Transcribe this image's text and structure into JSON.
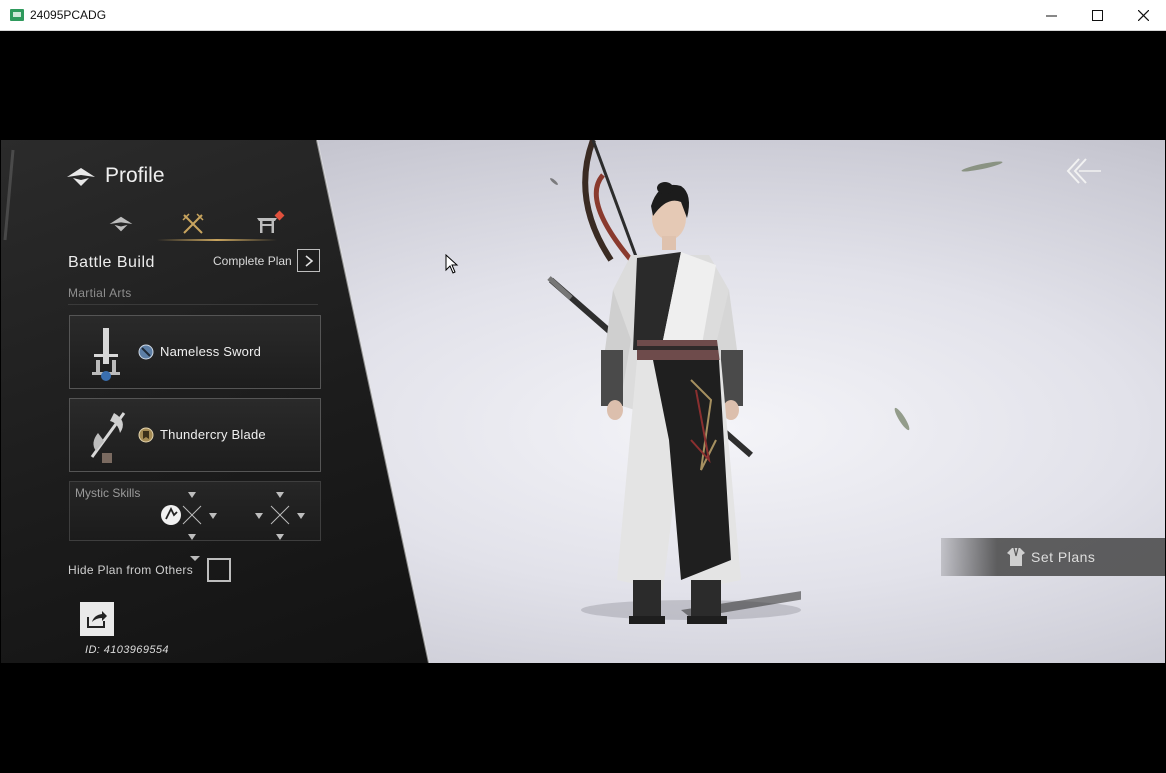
{
  "window": {
    "title": "24095PCADG",
    "minimize_icon": "minimize-icon",
    "maximize_icon": "maximize-icon",
    "close_icon": "close-icon"
  },
  "profile": {
    "title": "Profile",
    "tabs": [
      {
        "icon": "profile-emblem-icon",
        "active": false
      },
      {
        "icon": "crossed-swords-icon",
        "active": true
      },
      {
        "icon": "gate-icon",
        "active": false,
        "notification": true
      }
    ]
  },
  "battle_build": {
    "title": "Battle Build",
    "complete_plan_label": "Complete Plan",
    "martial_arts_label": "Martial Arts",
    "martial_arts": [
      {
        "name": "Nameless Sword",
        "weapon_icon": "sword-icon",
        "badge_icon": "nameless-badge-icon"
      },
      {
        "name": "Thundercry Blade",
        "weapon_icon": "halberd-icon",
        "badge_icon": "thundercry-badge-icon"
      }
    ],
    "mystic_skills_label": "Mystic Skills"
  },
  "hide_plan": {
    "label": "Hide Plan from Others",
    "checked": false
  },
  "player": {
    "id_text": "ID: 4103969554"
  },
  "actions": {
    "set_plans_label": "Set Plans",
    "back_icon": "back-arrow-icon"
  },
  "colors": {
    "accent_gold": "#c8a45e",
    "notification_red": "#e0503c",
    "panel_dark": "#1c1c1c"
  }
}
